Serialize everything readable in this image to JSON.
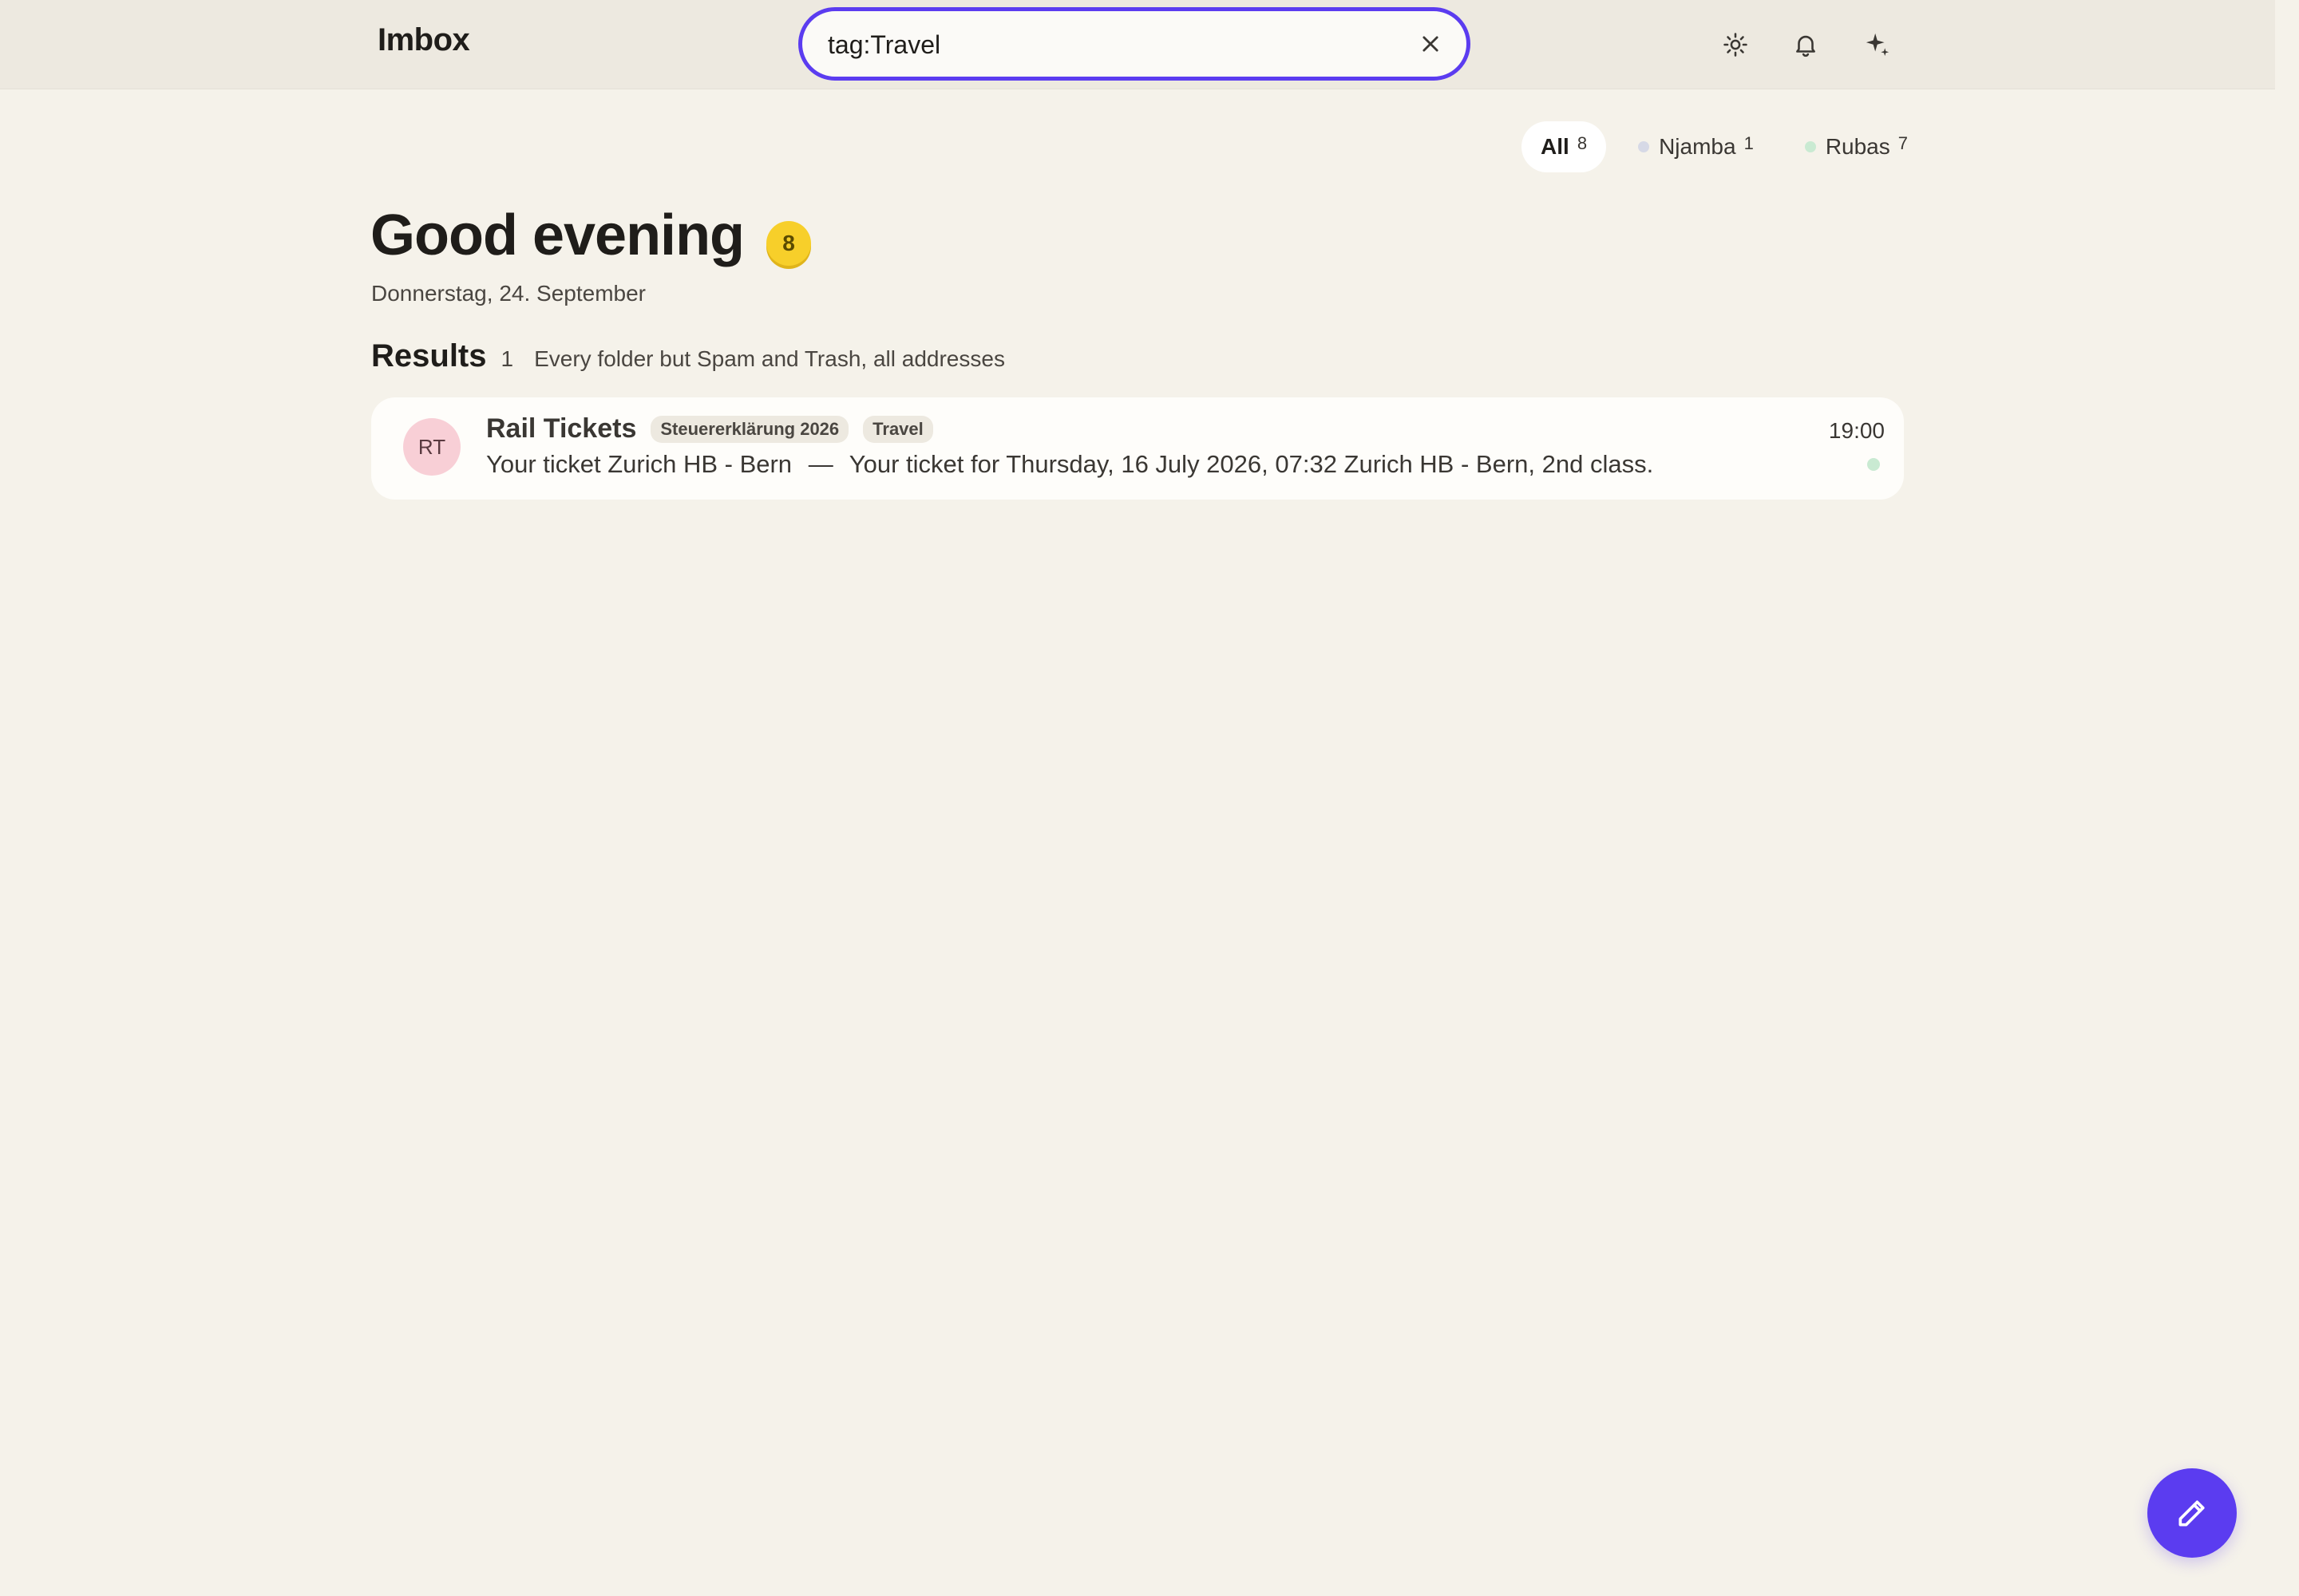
{
  "app": {
    "name": "Imbox"
  },
  "search": {
    "value": "tag:Travel",
    "clear_icon": "close-icon"
  },
  "header_icons": [
    "sun-icon",
    "bell-icon",
    "sparkles-icon"
  ],
  "filters": [
    {
      "label": "All",
      "count": "8",
      "active": true
    },
    {
      "label": "Njamba",
      "count": "1",
      "dot_color": "#d6d9e6"
    },
    {
      "label": "Rubas",
      "count": "7",
      "dot_color": "#c9ead2"
    }
  ],
  "greeting": {
    "title": "Good evening",
    "badge": "8",
    "date": "Donnerstag, 24. September"
  },
  "results": {
    "title": "Results",
    "count": "1",
    "scope": "Every folder but Spam and Trash, all addresses",
    "items": [
      {
        "initials": "RT",
        "sender": "Rail Tickets",
        "tags": [
          "Steuererklärung 2026",
          "Travel"
        ],
        "subject": "Your ticket Zurich HB - Bern",
        "separator": "—",
        "snippet": "Your ticket for Thursday, 16 July 2026, 07:32 Zurich HB - Bern, 2nd class.",
        "time": "19:00",
        "avatar_color": "#f8cfd6",
        "status_color": "#c9ead2"
      }
    ]
  },
  "colors": {
    "accent": "#5b3cf0",
    "background": "#f5f2ea",
    "badge": "#f7cf2a"
  },
  "compose": {
    "icon": "pencil-icon"
  }
}
